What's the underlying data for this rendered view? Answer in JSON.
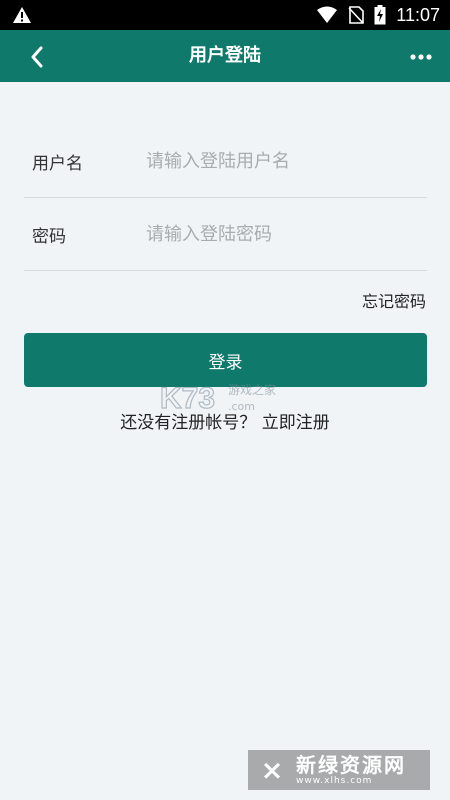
{
  "status_bar": {
    "time": "11:07",
    "icons": [
      "warning-icon",
      "wifi-icon",
      "no-sim-icon",
      "battery-charging-icon"
    ]
  },
  "app_bar": {
    "title": "用户登陆",
    "back_icon": "chevron-left-icon",
    "more_icon": "more-horizontal-icon",
    "background": "#0f7a6b"
  },
  "form": {
    "username": {
      "label": "用户名",
      "placeholder": "请输入登陆用户名",
      "value": ""
    },
    "password": {
      "label": "密码",
      "placeholder": "请输入登陆密码",
      "value": ""
    }
  },
  "forgot_password": "忘记密码",
  "login_button": "登录",
  "register": {
    "prompt": "还没有注册帐号？",
    "link": "立即注册"
  },
  "watermarks": {
    "k73": {
      "logo": "K73",
      "text": "游戏之家",
      "url": ".com"
    },
    "xlhs": {
      "text": "新绿资源网",
      "url": "www.xlhs.com"
    }
  },
  "colors": {
    "accent": "#0f7a6b",
    "background": "#f0f4f7"
  }
}
